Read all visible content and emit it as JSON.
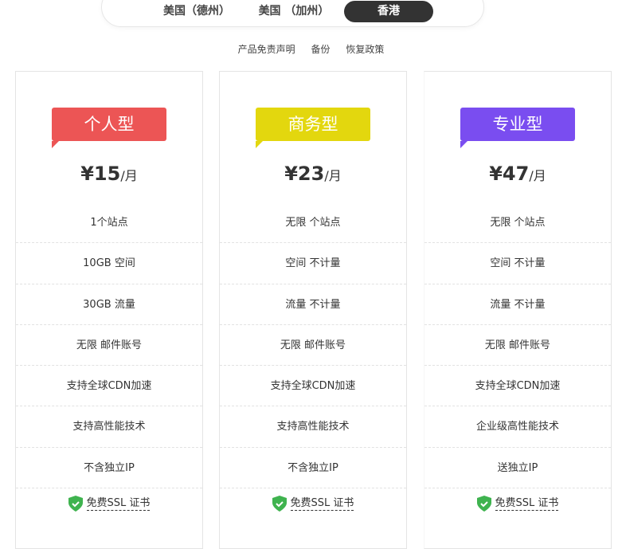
{
  "region_tabs": [
    {
      "label": "美国（德州）"
    },
    {
      "label": "美国 （加州）"
    },
    {
      "label": "香港",
      "active": true
    }
  ],
  "links": [
    "产品免责声明",
    "备份",
    "恢复政策"
  ],
  "plans": [
    {
      "name": "个人型",
      "color": "#ec5555",
      "price": "¥15",
      "unit": "/月",
      "features": [
        "1个站点",
        "10GB 空间",
        "30GB 流量",
        "无限 邮件账号",
        "支持全球CDN加速",
        "支持高性能技术",
        "不含独立IP"
      ],
      "ssl": "免费SSL 证书"
    },
    {
      "name": "商务型",
      "color": "#e3d70e",
      "price": "¥23",
      "unit": "/月",
      "features": [
        "无限 个站点",
        "空间 不计量",
        "流量 不计量",
        "无限 邮件账号",
        "支持全球CDN加速",
        "支持高性能技术",
        "不含独立IP"
      ],
      "ssl": "免费SSL 证书"
    },
    {
      "name": "专业型",
      "color": "#7a4df0",
      "price": "¥47",
      "unit": "/月",
      "features": [
        "无限 个站点",
        "空间 不计量",
        "流量 不计量",
        "无限 邮件账号",
        "支持全球CDN加速",
        "企业级高性能技术",
        "送独立IP"
      ],
      "ssl": "免费SSL 证书"
    }
  ],
  "colors": {
    "shield": "#3fb34f"
  }
}
